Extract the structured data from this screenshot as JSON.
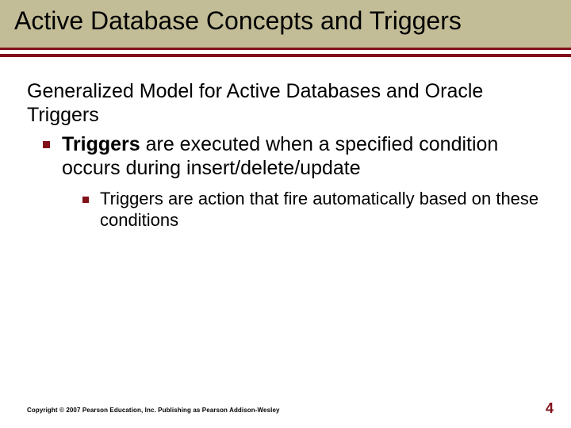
{
  "title": "Active Database Concepts and Triggers",
  "subheading": "Generalized Model for Active Databases and Oracle Triggers",
  "bullets": [
    {
      "bold": "Triggers",
      "rest": " are executed when a specified condition occurs during insert/delete/update",
      "sub": [
        "Triggers are action that fire automatically based on these conditions"
      ]
    }
  ],
  "footer": {
    "copyright": "Copyright © 2007 Pearson Education, Inc. Publishing as Pearson Addison-Wesley",
    "page": "4"
  },
  "theme": {
    "title_bg": "#c3bd97",
    "accent": "#82101b",
    "bullet_shape": "square"
  }
}
